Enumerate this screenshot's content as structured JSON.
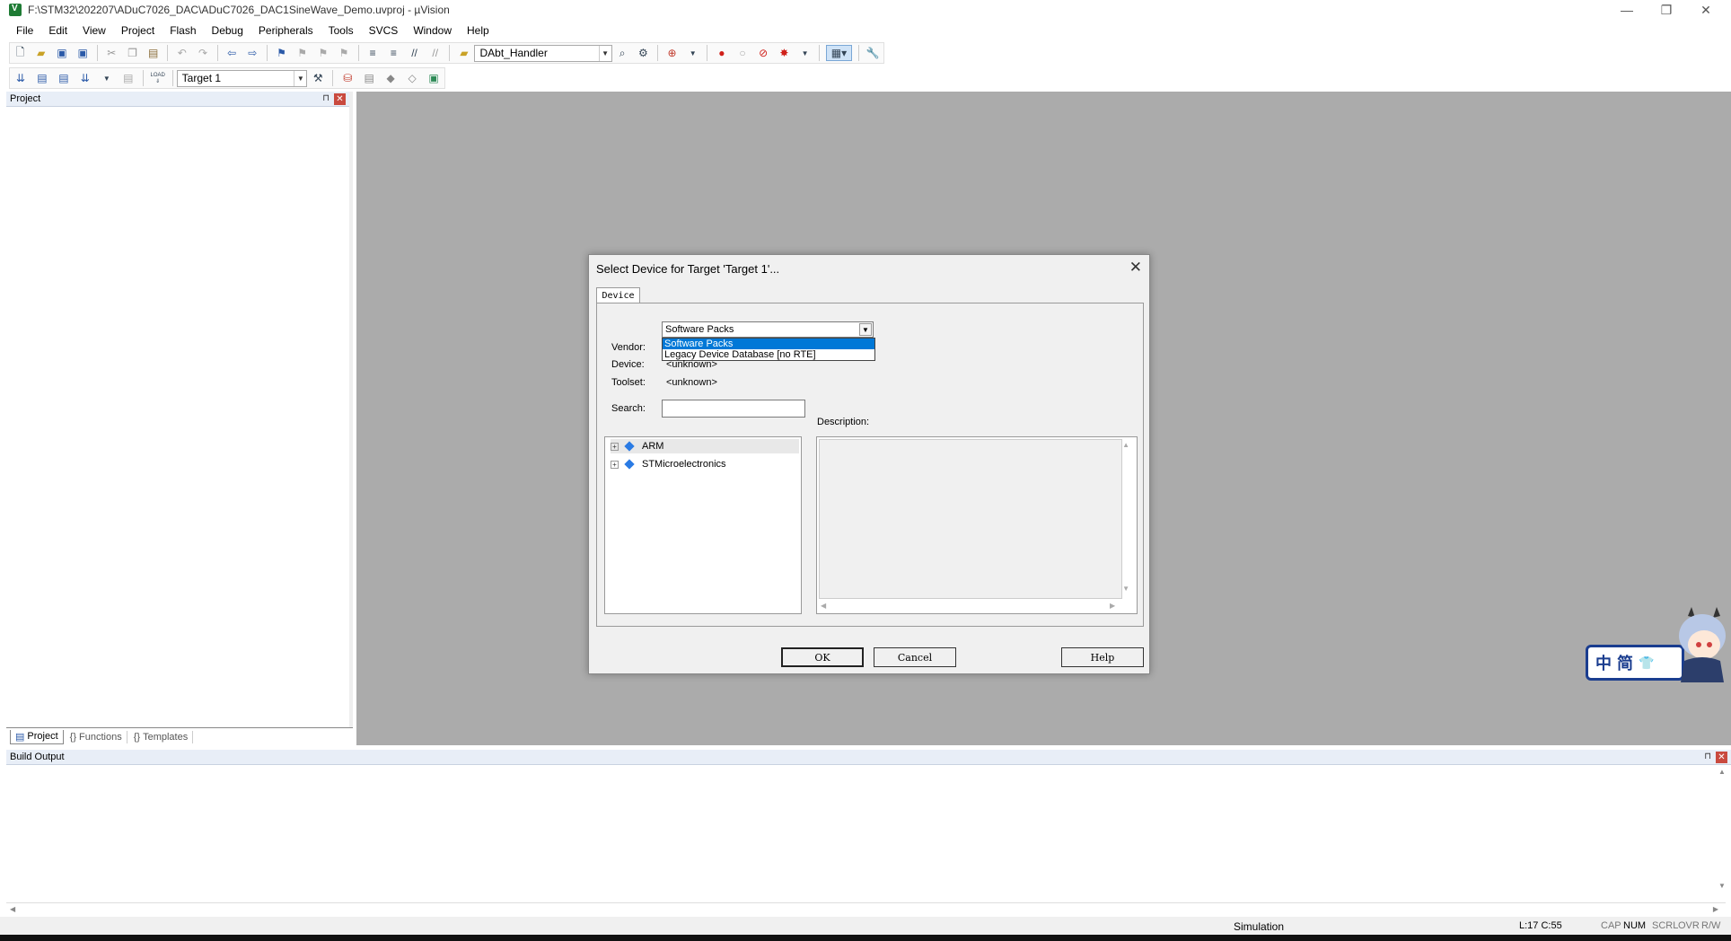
{
  "window": {
    "title": "F:\\STM32\\202207\\ADuC7026_DAC\\ADuC7026_DAC1SineWave_Demo.uvproj - µVision",
    "minimize": "—",
    "restore": "❐",
    "close": "✕"
  },
  "menu": [
    "File",
    "Edit",
    "View",
    "Project",
    "Flash",
    "Debug",
    "Peripherals",
    "Tools",
    "SVCS",
    "Window",
    "Help"
  ],
  "toolbar1": {
    "function_combo": "DAbt_Handler"
  },
  "toolbar2": {
    "target_combo": "Target 1",
    "load_label": "LOAD"
  },
  "project_pane": {
    "title": "Project",
    "pin": "⊓",
    "close": "✕",
    "tabs": [
      {
        "icon": "project-icon",
        "glyph": "▤",
        "label": "Project"
      },
      {
        "icon": "functions-icon",
        "glyph": "{}",
        "label": "Functions"
      },
      {
        "icon": "templates-icon",
        "glyph": "{}",
        "label": "Templates"
      }
    ]
  },
  "build_output": {
    "title": "Build Output",
    "pin": "⊓",
    "close": "✕"
  },
  "statusbar": {
    "mode": "Simulation",
    "position": "L:17 C:55",
    "cap": "CAP",
    "num": "NUM",
    "scrl": "SCRL",
    "ovr": "OVR",
    "rw": "R/W"
  },
  "dialog": {
    "title": "Select Device for Target 'Target 1'...",
    "close": "✕",
    "tab": "Device",
    "dropdown": {
      "value": "Software Packs",
      "options": [
        "Software Packs",
        "Legacy Device Database [no RTE]"
      ],
      "selected_index": 0
    },
    "vendor_label": "Vendor:",
    "device_label": "Device:",
    "device_value": "<unknown>",
    "toolset_label": "Toolset:",
    "toolset_value": "<unknown>",
    "search_label": "Search:",
    "search_value": "",
    "description_label": "Description:",
    "tree": [
      {
        "label": "ARM",
        "expander": "+"
      },
      {
        "label": "STMicroelectronics",
        "expander": "+"
      }
    ],
    "buttons": {
      "ok": "OK",
      "cancel": "Cancel",
      "help": "Help"
    }
  },
  "ime": {
    "chars": [
      "中",
      "简",
      "👕"
    ]
  },
  "colors": {
    "mdi_background": "#ababab",
    "pane_header": "#e8eef7",
    "selection": "#0078d7",
    "close_red": "#c94a3f"
  }
}
